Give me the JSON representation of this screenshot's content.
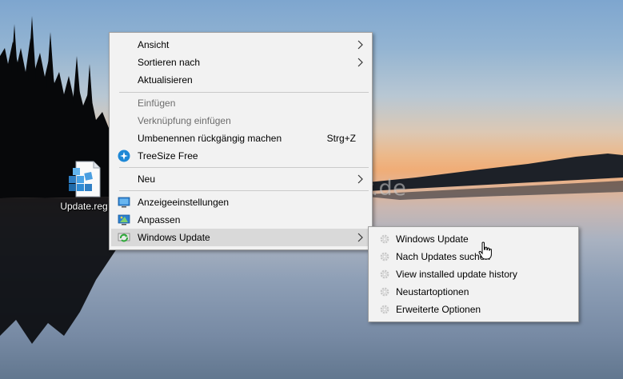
{
  "desktop": {
    "icon": {
      "label": "Update.reg",
      "icon": "registry-file-icon"
    },
    "watermark": "Deskmodder.de"
  },
  "context_menu": {
    "items": [
      {
        "label": "Ansicht",
        "submenu": true
      },
      {
        "label": "Sortieren nach",
        "submenu": true
      },
      {
        "label": "Aktualisieren"
      },
      {
        "separator": true
      },
      {
        "label": "Einfügen",
        "disabled": true
      },
      {
        "label": "Verknüpfung einfügen",
        "disabled": true
      },
      {
        "label": "Umbenennen rückgängig machen",
        "shortcut": "Strg+Z"
      },
      {
        "label": "TreeSize Free",
        "icon": "treesize-icon"
      },
      {
        "separator": true
      },
      {
        "label": "Neu",
        "submenu": true
      },
      {
        "separator": true
      },
      {
        "label": "Anzeigeeinstellungen",
        "icon": "display-settings-icon"
      },
      {
        "label": "Anpassen",
        "icon": "personalize-icon"
      },
      {
        "label": "Windows Update",
        "icon": "windows-update-icon",
        "submenu": true,
        "highlighted": true
      }
    ]
  },
  "windows_update_submenu": {
    "items": [
      {
        "label": "Windows Update",
        "icon": "gear-icon"
      },
      {
        "label": "Nach Updates suchen",
        "icon": "gear-icon"
      },
      {
        "label": "View installed update history",
        "icon": "gear-icon"
      },
      {
        "label": "Neustartoptionen",
        "icon": "gear-icon"
      },
      {
        "label": "Erweiterte Optionen",
        "icon": "gear-icon"
      }
    ]
  },
  "colors": {
    "menu_bg": "#f2f2f2",
    "highlight": "#d9d9d9",
    "disabled_text": "#6d6d6d",
    "accent_blue": "#1e88d6"
  }
}
